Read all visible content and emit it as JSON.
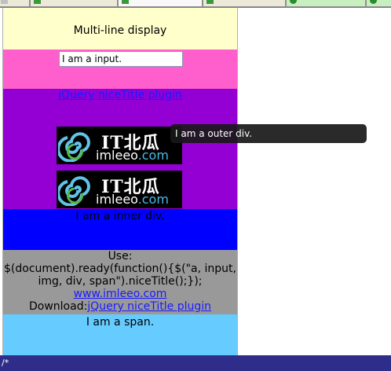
{
  "title_band": {
    "text": "Multi-line display"
  },
  "input_band": {
    "value": "I am a input."
  },
  "link_band": {
    "link_text": "jQuery niceTitle plugin"
  },
  "logo": {
    "chinese_text": "IT北瓜",
    "site_prefix": "imleeo",
    "site_suffix": ".com"
  },
  "inner_div": {
    "text": "I am a inner div."
  },
  "usage": {
    "label": "Use:",
    "code": "$(document).ready(function(){$(\"a, input, img, div, span\").niceTitle();});",
    "site_link": "www.imleeo.com",
    "download_label": "Download:",
    "download_link": "jQuery niceTitle plugin"
  },
  "span_band": {
    "text": "I am a span."
  },
  "tooltip": {
    "text": "I am a outer div."
  },
  "statusbar": {
    "text": "/*"
  },
  "colors": {
    "title_bg": "#ffffcc",
    "input_bg": "#ff5fcc",
    "link_bg": "#9400d3",
    "inner_bg": "#0000ff",
    "usage_bg": "#999999",
    "span_bg": "#66ccff",
    "status_bg": "#2e2e8a",
    "link": "#1a1aff"
  }
}
